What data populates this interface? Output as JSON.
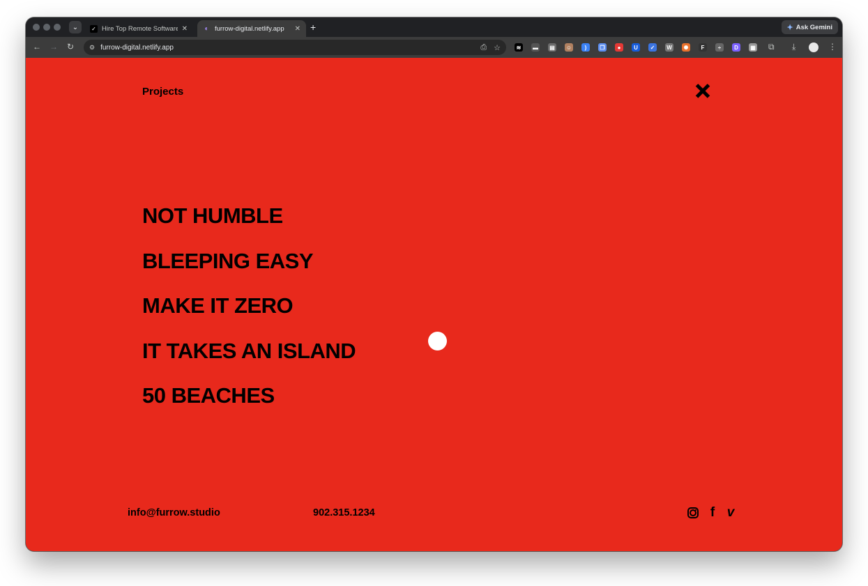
{
  "browser": {
    "tabs": [
      {
        "title": "Hire Top Remote Software De",
        "favicon": "check-logo-icon",
        "active": false
      },
      {
        "title": "furrow-digital.netlify.app",
        "favicon": "netlify-icon",
        "active": true
      }
    ],
    "new_tab_symbol": "+",
    "gemini_label": "Ask Gemini",
    "url": "furrow-digital.netlify.app",
    "extension_icons": [
      {
        "name": "ext-dark-icon",
        "glyph": "≋",
        "color": "#000000"
      },
      {
        "name": "ext-toggle-icon",
        "glyph": "▬",
        "color": "#555555"
      },
      {
        "name": "ext-reader-icon",
        "glyph": "▤",
        "color": "#6b6b6b"
      },
      {
        "name": "ext-avatar-icon",
        "glyph": "☺",
        "color": "#b08060"
      },
      {
        "name": "ext-wave-icon",
        "glyph": ")",
        "color": "#3b82f6"
      },
      {
        "name": "ext-copy-icon",
        "glyph": "❐",
        "color": "#5b8def"
      },
      {
        "name": "ext-red-icon",
        "glyph": "●",
        "color": "#e53935"
      },
      {
        "name": "ext-bitwarden-icon",
        "glyph": "U",
        "color": "#175ddc"
      },
      {
        "name": "ext-check-icon",
        "glyph": "✓",
        "color": "#3b74e0"
      },
      {
        "name": "ext-w-icon",
        "glyph": "W",
        "color": "#777777"
      },
      {
        "name": "ext-burst-icon",
        "glyph": "✺",
        "color": "#e8712c"
      },
      {
        "name": "ext-figma-icon",
        "glyph": "F",
        "color": "#333333"
      },
      {
        "name": "ext-ruler-icon",
        "glyph": "÷",
        "color": "#666666"
      },
      {
        "name": "ext-d-icon",
        "glyph": "D",
        "color": "#7b61ff"
      },
      {
        "name": "ext-grid-icon",
        "glyph": "▦",
        "color": "#999999"
      }
    ]
  },
  "page": {
    "nav_label": "Projects",
    "projects": [
      "NOT HUMBLE",
      "BLEEPING EASY",
      "MAKE IT ZERO",
      "IT TAKES AN ISLAND",
      "50 BEACHES"
    ],
    "email": "info@furrow.studio",
    "phone": "902.315.1234",
    "social": {
      "facebook": "f",
      "vimeo": "v"
    },
    "colors": {
      "background": "#e8291c",
      "text": "#000000"
    }
  }
}
